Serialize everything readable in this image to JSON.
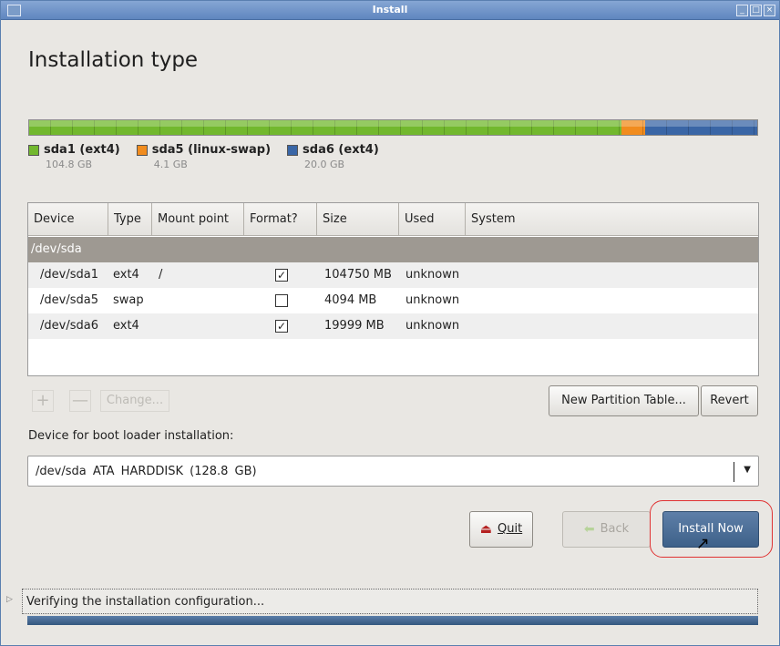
{
  "window": {
    "title": "Install",
    "menu_icon": "window-menu-icon",
    "minimize_icon": "minimize-icon",
    "maximize_icon": "maximize-icon",
    "close_icon": "close-icon"
  },
  "heading": "Installation type",
  "partitions_bar": {
    "segments": [
      {
        "name": "sda1 (ext4)",
        "size": "104.8 GB",
        "color": "#72b82e",
        "fraction": 0.814
      },
      {
        "name": "sda5 (linux-swap)",
        "size": "4.1 GB",
        "color": "#f18c1e",
        "fraction": 0.032
      },
      {
        "name": "sda6 (ext4)",
        "size": "20.0 GB",
        "color": "#3a66a6",
        "fraction": 0.154
      }
    ]
  },
  "table": {
    "headers": {
      "device": "Device",
      "type": "Type",
      "mount": "Mount point",
      "format": "Format?",
      "size": "Size",
      "used": "Used",
      "system": "System"
    },
    "group": "/dev/sda",
    "rows": [
      {
        "device": "/dev/sda1",
        "type": "ext4",
        "mount": "/",
        "format": true,
        "format_mark": "✓",
        "size": "104750 MB",
        "used": "unknown",
        "system": ""
      },
      {
        "device": "/dev/sda5",
        "type": "swap",
        "mount": "",
        "format": false,
        "format_mark": "",
        "size": "4094 MB",
        "used": "unknown",
        "system": ""
      },
      {
        "device": "/dev/sda6",
        "type": "ext4",
        "mount": "",
        "format": true,
        "format_mark": "✓",
        "size": "19999 MB",
        "used": "unknown",
        "system": ""
      }
    ]
  },
  "table_controls": {
    "add": "+",
    "remove": "—",
    "change": "Change...",
    "new_partition_table": "New Partition Table...",
    "revert": "Revert"
  },
  "bootloader": {
    "label": "Device for boot loader installation:",
    "value": "/dev/sda ATA HARDDISK (128.8 GB)"
  },
  "buttons": {
    "quit": "Quit",
    "back": "Back",
    "install_now": "Install Now"
  },
  "status": {
    "text": "Verifying the installation configuration...",
    "progress": 1.0
  },
  "colors": {
    "accent": "#3e6189",
    "highlight_ring": "#e03232"
  }
}
